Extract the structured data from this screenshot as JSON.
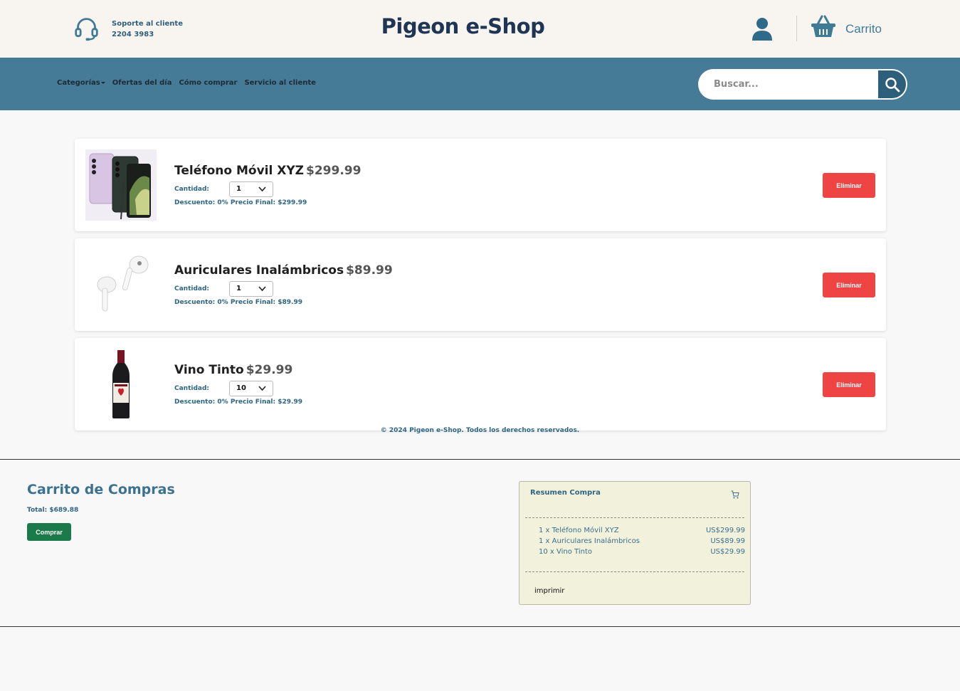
{
  "header": {
    "support_label": "Soporte al cliente",
    "support_phone": "2204 3983",
    "brand": "Pigeon e-Shop",
    "cart_label": "Carrito"
  },
  "nav": {
    "items": [
      "Categorías",
      "Ofertas del día",
      "Cómo comprar",
      "Servicio al cliente"
    ]
  },
  "search": {
    "placeholder": "Buscar..."
  },
  "items": [
    {
      "name": "Teléfono Móvil XYZ",
      "price": "$299.99",
      "qty_label": "Cantidad:",
      "qty": "1",
      "discount_label": "Descuento:",
      "discount": "0%",
      "final_label": "Precio Final:",
      "final_price": "$299.99",
      "delete_label": "Eliminar"
    },
    {
      "name": "Auriculares Inalámbricos",
      "price": "$89.99",
      "qty_label": "Cantidad:",
      "qty": "1",
      "discount_label": "Descuento:",
      "discount": "0%",
      "final_label": "Precio Final:",
      "final_price": "$89.99",
      "delete_label": "Eliminar"
    },
    {
      "name": "Vino Tinto",
      "price": "$29.99",
      "qty_label": "Cantidad:",
      "qty": "10",
      "discount_label": "Descuento:",
      "discount": "0%",
      "final_label": "Precio Final:",
      "final_price": "$29.99",
      "delete_label": "Eliminar"
    }
  ],
  "footer": {
    "copyright": "© 2024 Pigeon e-Shop. Todos los derechos reservados."
  },
  "cart": {
    "title": "Carrito de Compras",
    "total": "Total: $689.88",
    "buy_label": "Comprar"
  },
  "summary": {
    "title": "Resumen Compra",
    "rows": [
      {
        "desc": "1 x Teléfono Móvil XYZ",
        "amount": "US$299.99"
      },
      {
        "desc": "1 x Auriculares Inalámbricos",
        "amount": "US$89.99"
      },
      {
        "desc": "10 x Vino Tinto",
        "amount": "US$29.99"
      }
    ],
    "print_label": "imprimir"
  },
  "colors": {
    "navbar": "#457b97",
    "brand": "#1e3554",
    "delete": "#ef4444",
    "buy": "#1b7a4a",
    "receipt_bg": "#f1f1dc"
  }
}
